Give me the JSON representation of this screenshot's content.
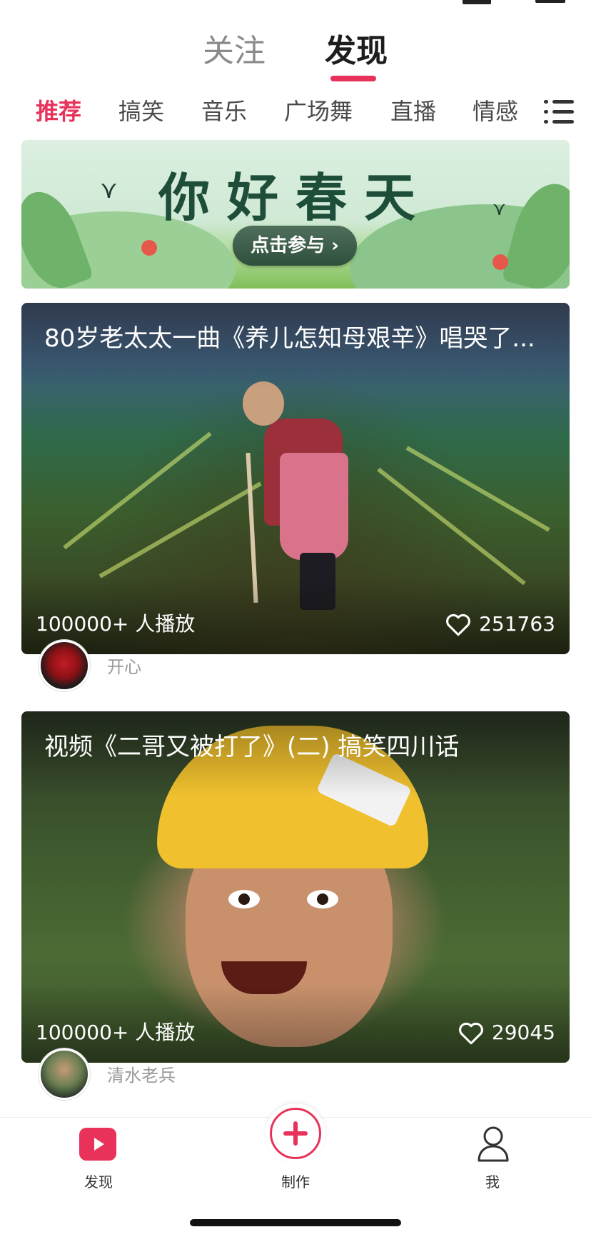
{
  "top_tabs": {
    "follow": "关注",
    "discover": "发现"
  },
  "categories": [
    "推荐",
    "搞笑",
    "音乐",
    "广场舞",
    "直播",
    "情感"
  ],
  "banner": {
    "title": "你好春天",
    "button": "点击参与 ›"
  },
  "feed": [
    {
      "title": "80岁老太太一曲《养儿怎知母艰辛》唱哭了...",
      "plays": "100000+ 人播放",
      "likes": "251763",
      "author": "开心"
    },
    {
      "title": "视频《二哥又被打了》(二) 搞笑四川话",
      "plays": "100000+ 人播放",
      "likes": "29045",
      "author": "清水老兵"
    }
  ],
  "bottom_nav": {
    "discover": "发现",
    "make": "制作",
    "me": "我"
  },
  "colors": {
    "accent": "#e8325a"
  },
  "icons": [
    "menu-icon",
    "heart-icon",
    "play-icon",
    "plus-icon",
    "user-icon"
  ]
}
